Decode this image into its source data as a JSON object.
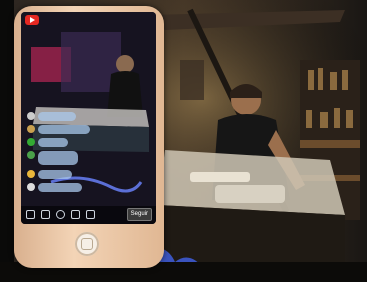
{
  "live_screen": {
    "app_logo": "youtube-logo-icon",
    "follow_label": "Seguir"
  },
  "colors": {
    "phone_body": "#e8c3a2",
    "youtube_red": "#e52822",
    "chat_bubble": "#aac8eb"
  }
}
